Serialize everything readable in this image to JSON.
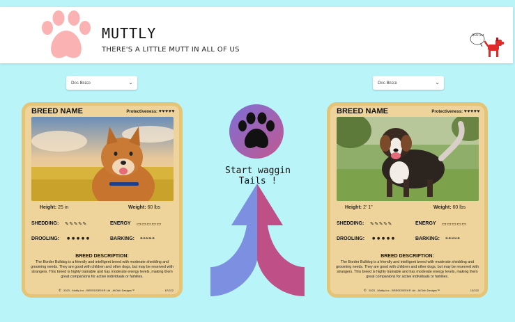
{
  "header": {
    "title": "MUTTLY",
    "tagline": "THERE'S A LITTLE MUTT IN ALL OF US",
    "speech_bubble": "Bark out",
    "logo_icon": "paw-icon",
    "logo_color": "#fbb2b2",
    "dog_icon_color": "#e02a2a"
  },
  "selectors": {
    "left": {
      "value": "Dog Breed"
    },
    "right": {
      "value": "Dog Breed"
    }
  },
  "center": {
    "text": "Start waggin Tails !",
    "paw_gradient": [
      "#7d6fd6",
      "#c15890"
    ],
    "arrow_left_color": "#7c8fe0",
    "arrow_right_color": "#bf4f87"
  },
  "cards": [
    {
      "breed_name": "BREED NAME",
      "protectiveness_label": "Protectiveness:",
      "protectiveness_icons": "♥♥♥♥♥",
      "height_label": "Height:",
      "height_value": "25 in",
      "weight_label": "Weight:",
      "weight_value": "60 lbs",
      "shedding_label": "SHEDDING:",
      "shedding_icons": "✎✎✎✎✎",
      "energy_label": "ENERGY",
      "energy_icons": "▭▭▭▭▭",
      "drooling_label": "DROOLING:",
      "drooling_icons": "● ● ● ● ●",
      "barking_label": "BARKING:",
      "barking_icons": "❝❝❝❝❝",
      "description_title": "BREED DESCRIPTION:",
      "description": "The Border Bulldog is a friendly and intelligent breed with moderate shedding and grooming needs. They are good with children and other dogs, but may be reserved with strangers. This breed is highly trainable and has moderate energy levels, making them great companions for active individuals or families.",
      "footer": "2023 - Muttly Inc - BREEDSEEKR Ltd - AIChib Designs™",
      "card_number": "67/222"
    },
    {
      "breed_name": "BREED NAME",
      "protectiveness_label": "Protectiveness:",
      "protectiveness_icons": "♥♥♥♥♥",
      "height_label": "Height:",
      "height_value": "2' 1\"",
      "weight_label": "Weight:",
      "weight_value": "60 lbs",
      "shedding_label": "SHEDDING:",
      "shedding_icons": "✎✎✎✎✎",
      "energy_label": "ENERGY",
      "energy_icons": "▭▭▭▭▭",
      "drooling_label": "DROOLING:",
      "drooling_icons": "● ● ● ● ●",
      "barking_label": "BARKING:",
      "barking_icons": "❝❝❝❝❝",
      "description_title": "BREED DESCRIPTION:",
      "description": "The Border Bulldog is a friendly and intelligent breed with moderate shedding and grooming needs. They are good with children and other dogs, but may be reserved with strangers. This breed is highly trainable and has moderate energy levels, making them great companions for active individuals or families.",
      "footer": "2023 - Muttly Inc - BREEDSEEKR Ltd - AIChib Designs™",
      "card_number": "13/222"
    }
  ]
}
